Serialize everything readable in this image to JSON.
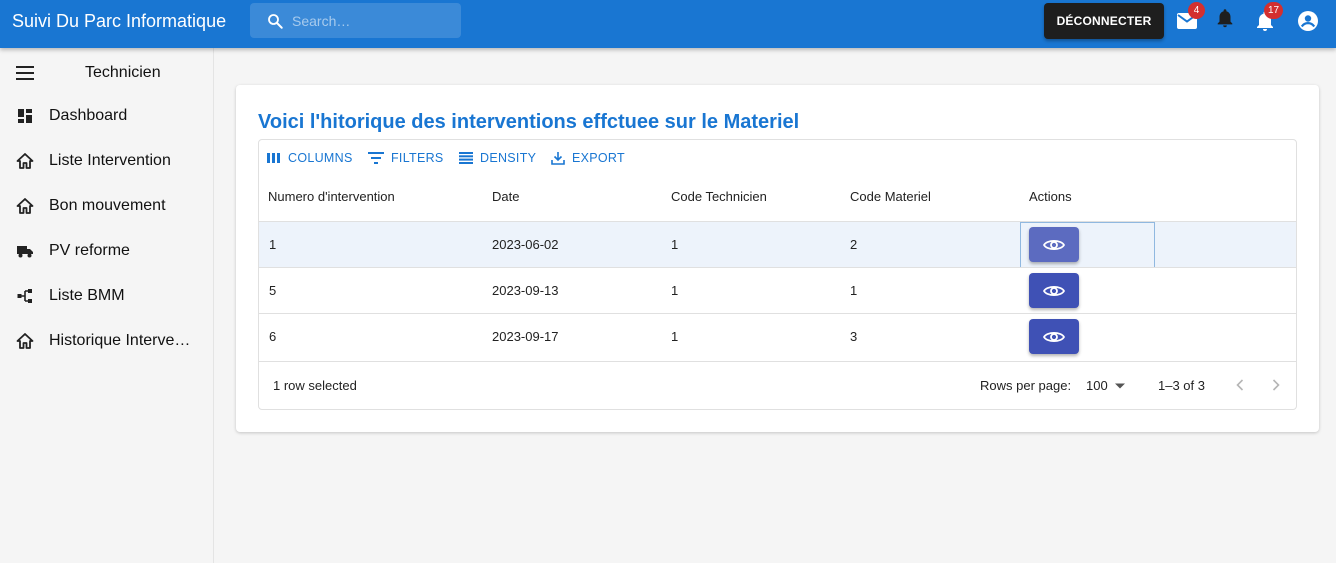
{
  "app": {
    "title": "Suivi Du Parc Informatique",
    "search_placeholder": "Search…",
    "logout_label": "DÉCONNECTER",
    "mail_badge": "4",
    "notifications_badge": "17",
    "accent_color": "#1976d2"
  },
  "sidebar": {
    "title": "Technicien",
    "items": [
      {
        "label": "Dashboard",
        "icon": "dashboard-icon"
      },
      {
        "label": "Liste Intervention",
        "icon": "home-icon"
      },
      {
        "label": "Bon mouvement",
        "icon": "home-icon"
      },
      {
        "label": "PV reforme",
        "icon": "truck-icon"
      },
      {
        "label": "Liste BMM",
        "icon": "device-hub-icon"
      },
      {
        "label": "Historique Intervention",
        "icon": "home-icon"
      }
    ]
  },
  "main": {
    "heading": "Voici l'hitorique des interventions effctuee sur le Materiel",
    "toolbar": {
      "columns": "COLUMNS",
      "filters": "FILTERS",
      "density": "DENSITY",
      "export": "EXPORT"
    },
    "columns": [
      "Numero d'intervention",
      "Date",
      "Code Technicien",
      "Code Materiel",
      "Actions"
    ],
    "rows": [
      {
        "numero": "1",
        "date": "2023-06-02",
        "technicien": "1",
        "materiel": "2",
        "selected": true
      },
      {
        "numero": "5",
        "date": "2023-09-13",
        "technicien": "1",
        "materiel": "1",
        "selected": false
      },
      {
        "numero": "6",
        "date": "2023-09-17",
        "technicien": "1",
        "materiel": "3",
        "selected": false
      }
    ],
    "footer": {
      "selected_text": "1 row selected",
      "rows_per_page_label": "Rows per page:",
      "rows_per_page_value": "100",
      "range": "1–3 of 3"
    }
  }
}
